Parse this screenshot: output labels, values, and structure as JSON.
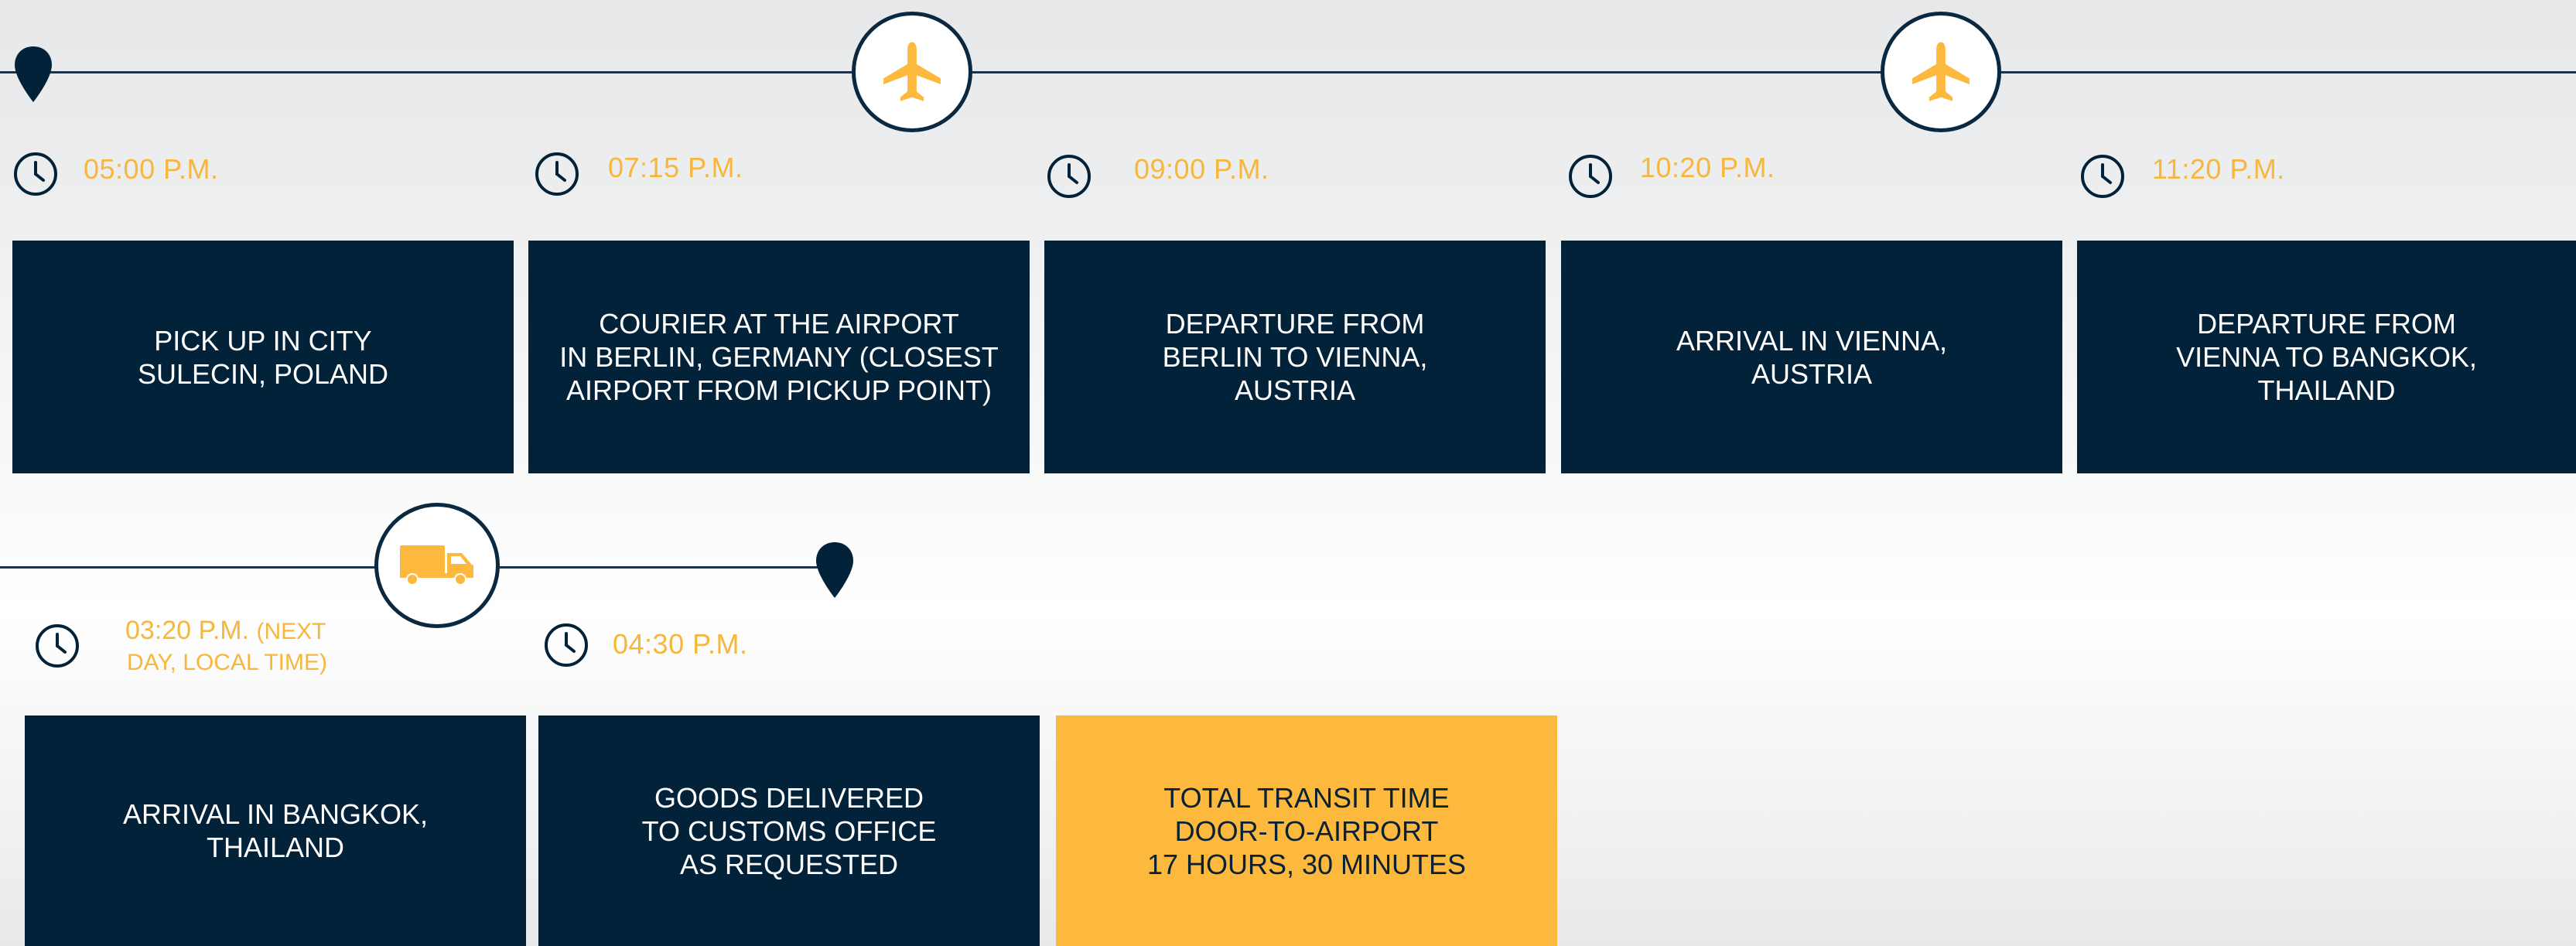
{
  "colors": {
    "navy": "#02223a",
    "accent": "#fdb93e",
    "time_text": "#f6b73c",
    "line": "#1e3347"
  },
  "icons": {
    "pin": "location-pin-icon",
    "plane": "airplane-icon",
    "truck": "delivery-truck-icon",
    "clock": "clock-icon"
  },
  "row1": {
    "steps": [
      {
        "time": "05:00 P.M.",
        "label": "PICK UP IN CITY\nSULECIN, POLAND"
      },
      {
        "time": "07:15 P.M.",
        "label": "COURIER AT THE AIRPORT\nIN BERLIN, GERMANY (CLOSEST\nAIRPORT FROM PICKUP POINT)"
      },
      {
        "time": "09:00 P.M.",
        "label": "DEPARTURE FROM\nBERLIN TO VIENNA,\nAUSTRIA"
      },
      {
        "time": "10:20 P.M.",
        "label": "ARRIVAL  IN VIENNA,\nAUSTRIA"
      },
      {
        "time": "11:20 P.M.",
        "label": "DEPARTURE FROM\nVIENNA TO BANGKOK,\nTHAILAND"
      }
    ]
  },
  "row2": {
    "steps": [
      {
        "time": "03:20 P.M.",
        "time_note_a": "(NEXT",
        "time_note_b": "DAY, LOCAL TIME)",
        "label": "ARRIVAL IN BANGKOK,\nTHAILAND"
      },
      {
        "time": "04:30 P.M.",
        "label": "GOODS DELIVERED\nTO CUSTOMS OFFICE\nAS REQUESTED"
      }
    ],
    "summary": {
      "label": "TOTAL TRANSIT TIME\nDOOR-TO-AIRPORT\n17 HOURS, 30 MINUTES"
    }
  }
}
